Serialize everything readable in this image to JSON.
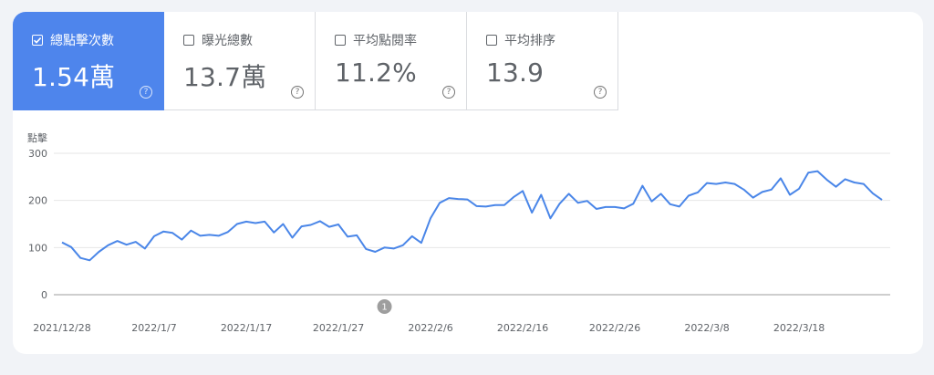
{
  "metrics": [
    {
      "label": "總點擊次數",
      "value": "1.54萬",
      "checked": true,
      "help": "?"
    },
    {
      "label": "曝光總數",
      "value": "13.7萬",
      "checked": false,
      "help": "?"
    },
    {
      "label": "平均點閱率",
      "value": "11.2%",
      "checked": false,
      "help": "?"
    },
    {
      "label": "平均排序",
      "value": "13.9",
      "checked": false,
      "help": "?"
    }
  ],
  "colors": {
    "accent": "#4e85ec",
    "line": "#4a86e8",
    "grid": "#e6e6e6"
  },
  "chart_data": {
    "type": "line",
    "ylabel": "點擊",
    "ylim": [
      0,
      300
    ],
    "yticks": [
      0,
      100,
      200,
      300
    ],
    "xlabels": [
      "2021/12/28",
      "2022/1/7",
      "2022/1/17",
      "2022/1/27",
      "2022/2/6",
      "2022/2/16",
      "2022/2/26",
      "2022/3/8",
      "2022/3/18"
    ],
    "annotation": {
      "label": "1",
      "date_index": 35
    },
    "series": [
      {
        "values": [
          111,
          101,
          78,
          73,
          91,
          105,
          114,
          106,
          112,
          98,
          124,
          134,
          131,
          117,
          136,
          125,
          127,
          125,
          133,
          150,
          155,
          152,
          155,
          132,
          150,
          121,
          145,
          148,
          156,
          144,
          149,
          123,
          126,
          97,
          91,
          100,
          98,
          105,
          124,
          110,
          162,
          195,
          205,
          203,
          202,
          188,
          187,
          190,
          190,
          207,
          220,
          174,
          212,
          162,
          193,
          214,
          195,
          199,
          182,
          186,
          186,
          183,
          193,
          231,
          198,
          214,
          192,
          187,
          210,
          217,
          237,
          235,
          238,
          235,
          223,
          206,
          218,
          223,
          247,
          212,
          225,
          259,
          262,
          244,
          229,
          245,
          238,
          235,
          215,
          201
        ]
      }
    ]
  }
}
